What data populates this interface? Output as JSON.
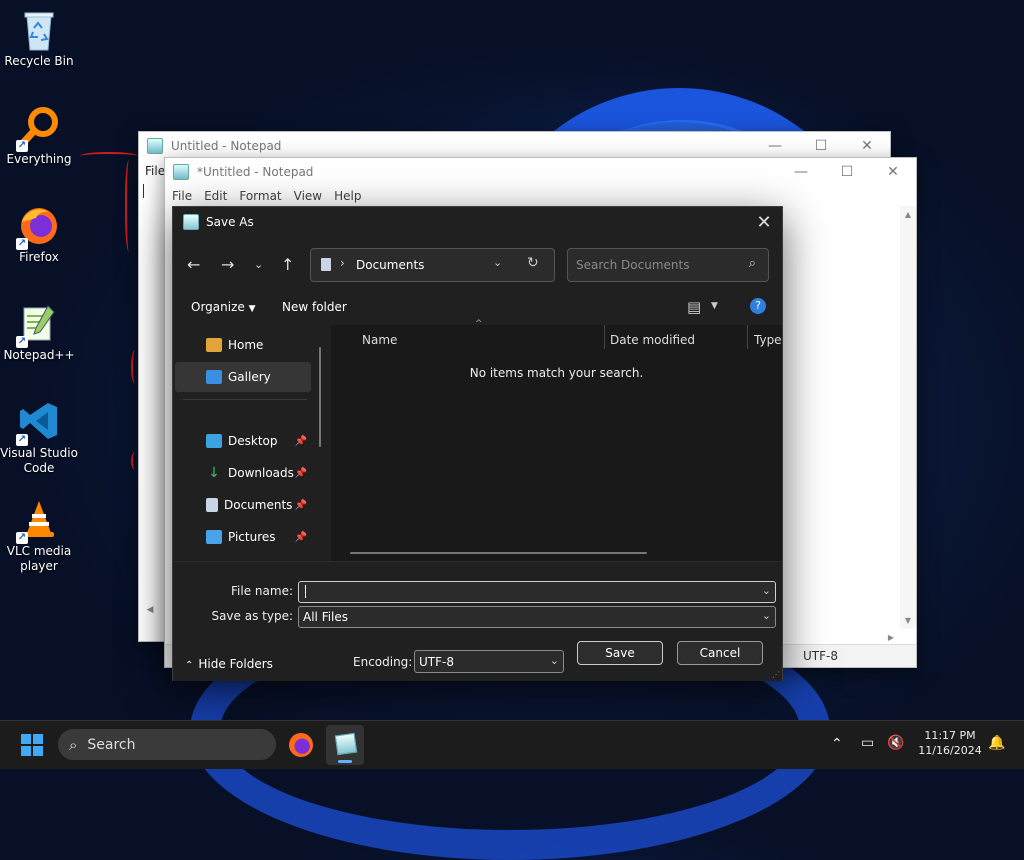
{
  "desktop": {
    "icons": [
      {
        "label": "Recycle Bin",
        "icon": "recycle-bin-icon"
      },
      {
        "label": "Everything",
        "icon": "everything-search-icon"
      },
      {
        "label": "Firefox",
        "icon": "firefox-icon"
      },
      {
        "label": "Notepad++",
        "icon": "notepadpp-icon"
      },
      {
        "label": "Visual Studio Code",
        "icon": "vscode-icon"
      },
      {
        "label": "VLC media player",
        "icon": "vlc-icon"
      }
    ]
  },
  "notepad_back": {
    "title": "Untitled - Notepad",
    "menu_first": "File"
  },
  "notepad_front": {
    "title": "*Untitled - Notepad",
    "menu": [
      "File",
      "Edit",
      "Format",
      "View",
      "Help"
    ],
    "status_encoding": "UTF-8"
  },
  "save_dialog": {
    "title": "Save As",
    "address": "Documents",
    "search_placeholder": "Search Documents",
    "organize_label": "Organize",
    "new_folder_label": "New folder",
    "help_glyph": "?",
    "sidebar": [
      {
        "label": "Home",
        "icon": "home-icon"
      },
      {
        "label": "Gallery",
        "icon": "gallery-icon",
        "selected": true
      },
      {
        "label": "Desktop",
        "icon": "desktop-folder-icon",
        "pinned": true
      },
      {
        "label": "Downloads",
        "icon": "downloads-icon",
        "pinned": true
      },
      {
        "label": "Documents",
        "icon": "documents-icon",
        "pinned": true
      },
      {
        "label": "Pictures",
        "icon": "pictures-icon",
        "pinned": true
      }
    ],
    "columns": [
      "Name",
      "Date modified",
      "Type"
    ],
    "empty_message": "No items match your search.",
    "file_name_label": "File name:",
    "file_name_value": "",
    "save_type_label": "Save as type:",
    "save_type_value": "All Files",
    "hide_folders_label": "Hide Folders",
    "encoding_label": "Encoding:",
    "encoding_value": "UTF-8",
    "save_button": "Save",
    "cancel_button": "Cancel"
  },
  "taskbar": {
    "search_label": "Search",
    "time": "11:17 PM",
    "date": "11/16/2024"
  }
}
